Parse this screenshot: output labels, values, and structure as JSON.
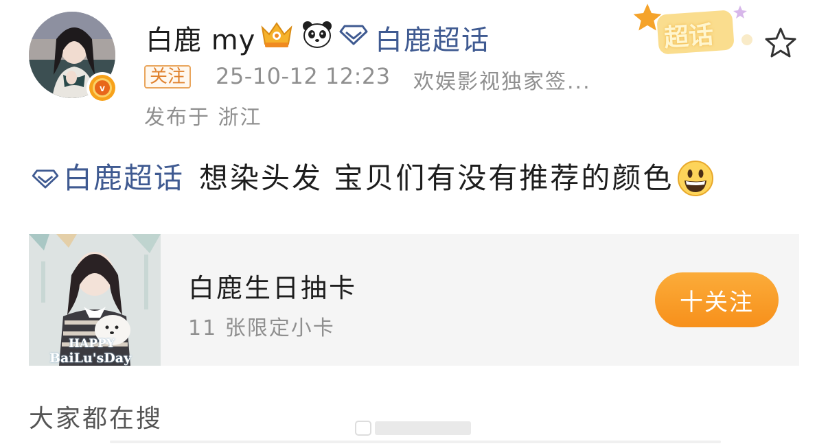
{
  "post": {
    "author": {
      "name": "白鹿 my",
      "follow_tag": "关注",
      "verified_badge_letter": "v"
    },
    "header_topic": "白鹿超话",
    "supertopic_stamp": "超话",
    "timestamp": "25-10-12 12:23",
    "source": "欢娱影视独家签...",
    "location": "发布于 浙江",
    "content": {
      "topic": "白鹿超话",
      "text": "想染头发 宝贝们有没有推荐的颜色"
    }
  },
  "card": {
    "title": "白鹿生日抽卡",
    "subtitle": "11 张限定小卡",
    "follow_button": "十关注",
    "image_text_line1": "HAPPY",
    "image_text_line2": "BaiLu'sDay"
  },
  "search_section": {
    "title": "大家都在搜"
  },
  "colors": {
    "topic_blue": "#3f5a91",
    "accent_orange": "#f7901b",
    "meta_gray": "#8f8f8f"
  },
  "icons": {
    "crown": "crown-badge-icon",
    "panda": "panda-icon",
    "topic": "diamond-topic-icon",
    "star": "star-outline-icon",
    "emoji": "grinning-face-icon"
  }
}
